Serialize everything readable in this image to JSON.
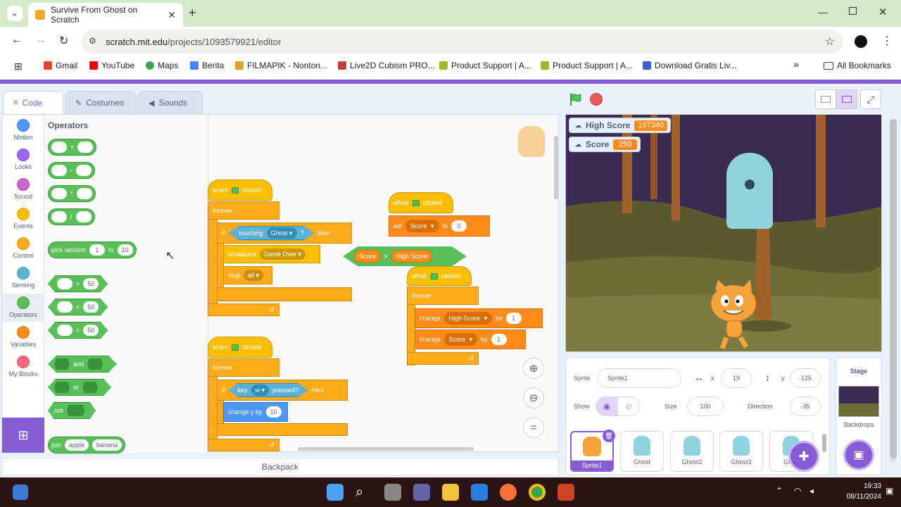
{
  "browser": {
    "tab_title": "Survive From Ghost on Scratch",
    "url_domain": "scratch.mit.edu",
    "url_path": "/projects/1093579921/editor",
    "bookmarks": [
      "Gmail",
      "YouTube",
      "Maps",
      "Berita",
      "FILMAPIK - Nonton...",
      "Live2D Cubism PRO...",
      "Product Support | A...",
      "Product Support | A...",
      "Download Gratis Liv..."
    ],
    "all_bookmarks": "All Bookmarks",
    "overflow": "»"
  },
  "editor_tabs": [
    "Code",
    "Costumes",
    "Sounds"
  ],
  "categories": [
    {
      "label": "Motion",
      "color": "#4c97ff"
    },
    {
      "label": "Looks",
      "color": "#9966ff"
    },
    {
      "label": "Sound",
      "color": "#cf63cf"
    },
    {
      "label": "Events",
      "color": "#ffbf00"
    },
    {
      "label": "Control",
      "color": "#ffab19"
    },
    {
      "label": "Sensing",
      "color": "#5cb1d6"
    },
    {
      "label": "Operators",
      "color": "#59c059"
    },
    {
      "label": "Variables",
      "color": "#ff8c1a"
    },
    {
      "label": "My Blocks",
      "color": "#ff6680"
    }
  ],
  "palette": {
    "heading": "Operators",
    "plus": "+",
    "minus": "-",
    "times": "*",
    "divide": "/",
    "pick_random": "pick random",
    "pick_from": "1",
    "pick_to_word": "to",
    "pick_to": "10",
    "gt": ">",
    "lt": "<",
    "eq": "=",
    "cmp_value": "50",
    "and": "and",
    "or": "or",
    "not": "not",
    "join": "join",
    "join_a": "apple",
    "join_b": "banana"
  },
  "scripts": {
    "when": "when",
    "clicked": "clicked",
    "forever": "forever",
    "if": "if",
    "then": "then",
    "touching": "touching",
    "ghost": "Ghost",
    "q": "?",
    "broadcast": "broadcast",
    "game_over": "Game Over",
    "stop": "stop",
    "all": "all",
    "set": "set",
    "score": "Score",
    "to": "to",
    "zero": "0",
    "high_score": "High Score",
    "gt": ">",
    "change": "change",
    "by": "by",
    "one": "1",
    "key": "key",
    "w": "w",
    "pressed": "pressed?",
    "change_y": "change y by",
    "ten": "10"
  },
  "backpack": "Backpack",
  "stage": {
    "monitors": [
      {
        "label": "High Score",
        "value": "167340"
      },
      {
        "label": "Score",
        "value": "250"
      }
    ]
  },
  "sprite_info": {
    "sprite_label": "Sprite",
    "sprite_name": "Sprite1",
    "x_label": "x",
    "x": "19",
    "y_label": "y",
    "y": "-125",
    "show_label": "Show",
    "size_label": "Size",
    "size": "100",
    "direction_label": "Direction",
    "direction": "-35"
  },
  "sprites": [
    "Sprite1",
    "Ghost",
    "Ghost2",
    "Ghost3",
    "Ghos"
  ],
  "stage_panel": {
    "title": "Stage",
    "backdrops": "Backdrops"
  },
  "clock": {
    "time": "19:33",
    "date": "08/11/2024"
  }
}
